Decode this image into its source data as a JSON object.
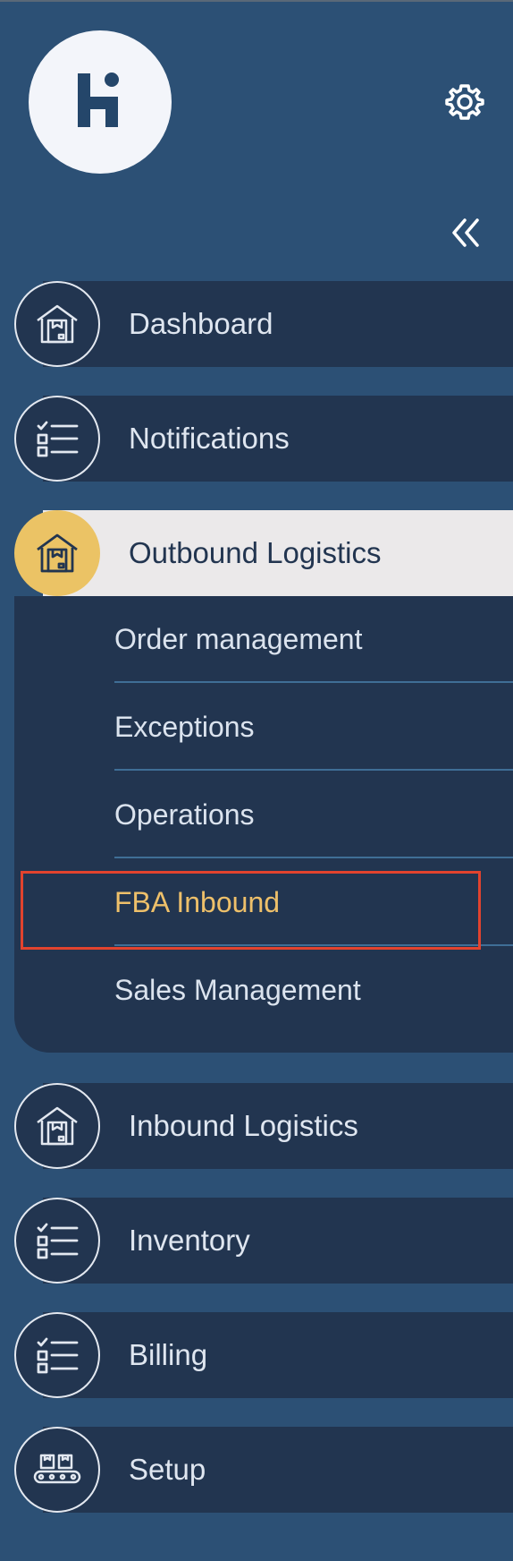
{
  "brand": {
    "logo_letter": "H"
  },
  "header": {
    "settings_icon": "gear-icon",
    "collapse_icon": "double-chevron-left-icon"
  },
  "nav": {
    "items": [
      {
        "label": "Dashboard",
        "icon": "warehouse-icon"
      },
      {
        "label": "Notifications",
        "icon": "checklist-icon"
      },
      {
        "label": "Outbound Logistics",
        "icon": "warehouse-icon",
        "active": true,
        "submenu": [
          {
            "label": "Order management"
          },
          {
            "label": "Exceptions"
          },
          {
            "label": "Operations"
          },
          {
            "label": "FBA Inbound",
            "active": true
          },
          {
            "label": "Sales Management"
          }
        ]
      },
      {
        "label": "Inbound Logistics",
        "icon": "warehouse-icon"
      },
      {
        "label": "Inventory",
        "icon": "checklist-icon"
      },
      {
        "label": "Billing",
        "icon": "checklist-icon"
      },
      {
        "label": "Setup",
        "icon": "conveyor-icon"
      }
    ]
  },
  "colors": {
    "background": "#2c5075",
    "nav_bar": "#223550",
    "active_bar": "#ebe9ea",
    "accent": "#ebc365",
    "highlight": "#e2432e"
  }
}
